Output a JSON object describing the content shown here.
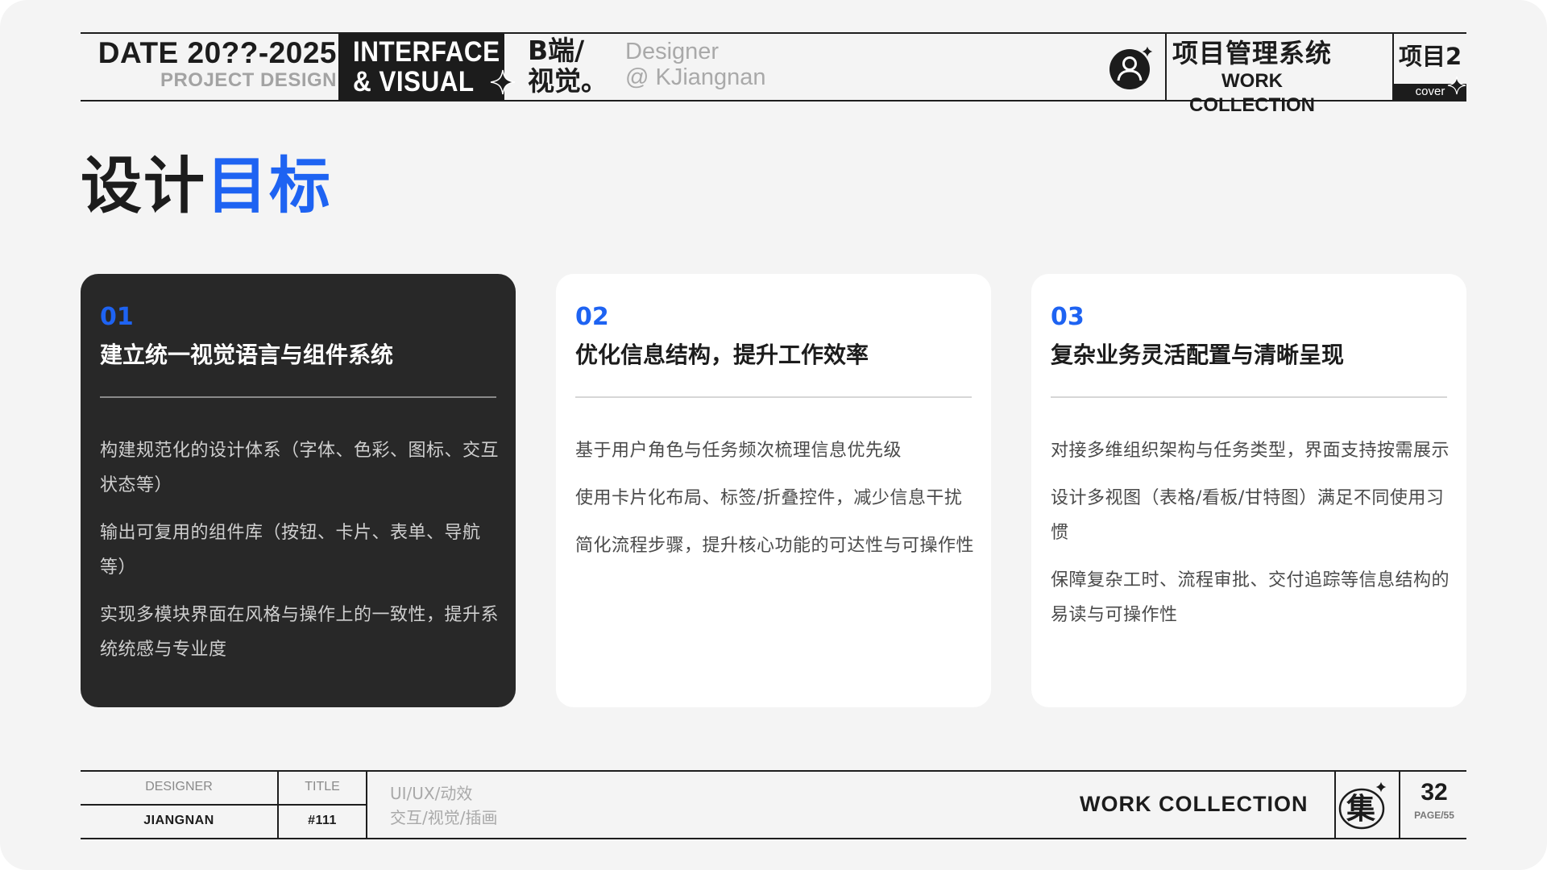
{
  "header": {
    "date": "DATE  20??-2025",
    "project_design": "PROJECT DESIGN",
    "black_box": {
      "line1": "INTERFACE",
      "line2": "&   VISUAL"
    },
    "b_side": {
      "line1": "B端/",
      "line2": "视觉。"
    },
    "designer": {
      "line1": "Designer",
      "line2": "@ KJiangnan"
    },
    "system": {
      "cn": "项目管理系统",
      "en": "WORK COLLECTION"
    },
    "project": "项目2",
    "cover": "cover",
    "icons": [
      "sparkle-icon",
      "user-avatar-icon"
    ]
  },
  "title": {
    "dark": "设计",
    "blue": "目标"
  },
  "accent_color": "#1e63f2",
  "cards": [
    {
      "number": "01",
      "heading": "建立统一视觉语言与组件系统",
      "theme": "dark",
      "paragraphs": [
        "构建规范化的设计体系（字体、色彩、图标、交互状态等）",
        "输出可复用的组件库（按钮、卡片、表单、导航等）",
        "实现多模块界面在风格与操作上的一致性，提升系统统感与专业度"
      ]
    },
    {
      "number": "02",
      "heading": "优化信息结构，提升工作效率",
      "theme": "light",
      "paragraphs": [
        "基于用户角色与任务频次梳理信息优先级",
        "使用卡片化布局、标签/折叠控件，减少信息干扰",
        "简化流程步骤，提升核心功能的可达性与可操作性"
      ]
    },
    {
      "number": "03",
      "heading": "复杂业务灵活配置与清晰呈现",
      "theme": "light",
      "paragraphs": [
        "对接多维组织架构与任务类型，界面支持按需展示",
        "设计多视图（表格/看板/甘特图）满足不同使用习惯",
        "保障复杂工时、流程审批、交付追踪等信息结构的易读与可操作性"
      ]
    }
  ],
  "footer": {
    "designer_label": "DESIGNER",
    "designer_value": "JIANGNAN",
    "title_label": "TITLE",
    "title_value": "#111",
    "tags_line1": "UI/UX/动效",
    "tags_line2": "交互/视觉/插画",
    "work_collection": "WORK COLLECTION",
    "page_number": "32",
    "page_total": "PAGE/55"
  }
}
